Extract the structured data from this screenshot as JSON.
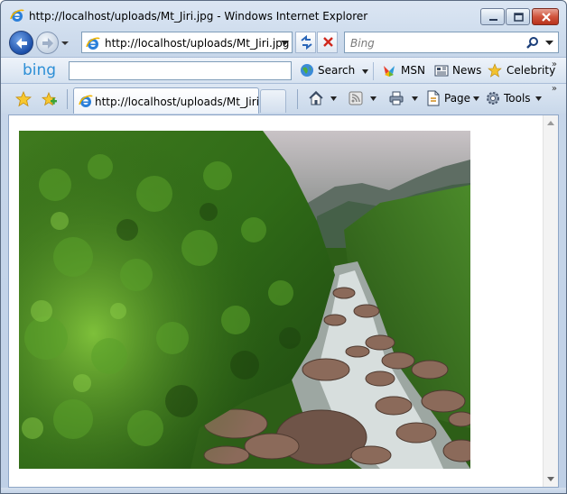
{
  "window": {
    "title": "http://localhost/uploads/Mt_Jiri.jpg - Windows Internet Explorer"
  },
  "address_bar": {
    "url": "http://localhost/uploads/Mt_Jiri.jpg"
  },
  "search": {
    "placeholder": "Bing"
  },
  "bing_toolbar": {
    "logo": "bing",
    "search_label": "Search",
    "msn_label": "MSN",
    "news_label": "News",
    "celebrity_label": "Celebrity"
  },
  "tabs": [
    {
      "title": "http://localhost/uploads/Mt_Jiri..."
    }
  ],
  "command_bar": {
    "page_label": "Page",
    "tools_label": "Tools"
  },
  "colors": {
    "ie_blue": "#1b4ea8",
    "close_red": "#d1553e",
    "bing_blue": "#2d8fd6"
  },
  "icons": [
    "ie-icon",
    "back-arrow-icon",
    "forward-arrow-icon",
    "refresh-icon",
    "stop-icon",
    "search-icon",
    "favorites-star-icon",
    "add-favorites-icon",
    "home-icon",
    "rss-feed-icon",
    "print-icon",
    "page-icon",
    "gear-icon",
    "msn-butterfly-icon",
    "news-icon",
    "celebrity-star-icon"
  ]
}
